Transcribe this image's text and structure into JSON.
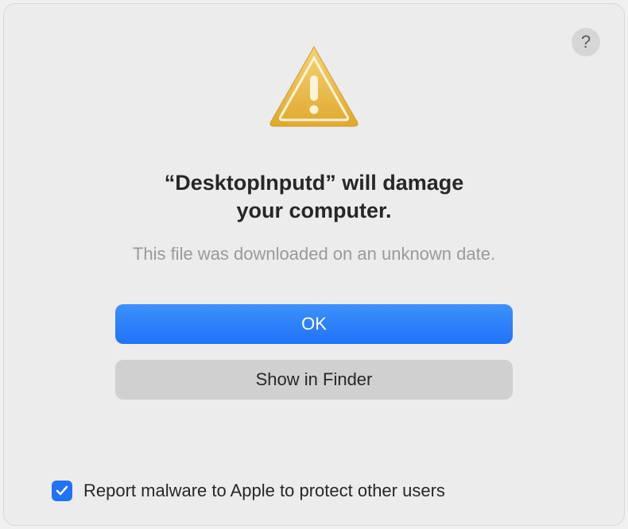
{
  "dialog": {
    "help_icon": "?",
    "title_line1": "“DesktopInputd” will damage",
    "title_line2": "your computer.",
    "subtitle": "This file was downloaded on an unknown date.",
    "primary_button": "OK",
    "secondary_button": "Show in Finder",
    "checkbox_label": "Report malware to Apple to protect other users",
    "checkbox_checked": true,
    "colors": {
      "primary_blue": "#2172f9",
      "background": "#ececec",
      "warning_yellow": "#e8b83e"
    }
  }
}
